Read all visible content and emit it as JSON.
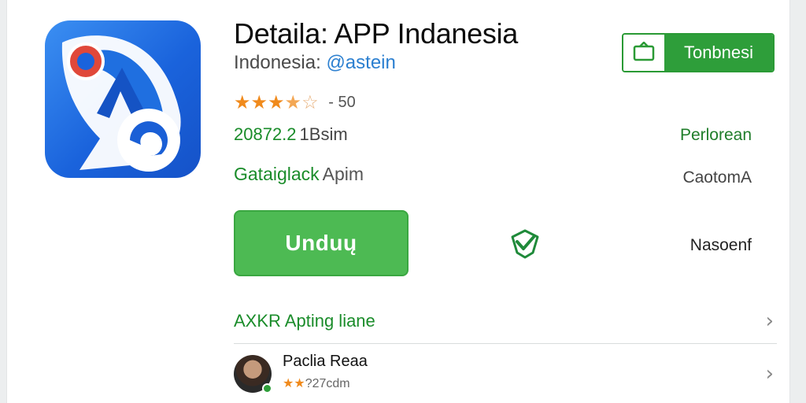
{
  "app": {
    "title": "Detaila: APP Indanesia",
    "developer_prefix": "Indonesia:",
    "developer_name": "@astein",
    "icon": "app-logo-icon",
    "brand_colors": [
      "#1a63dc",
      "#3b8ff2",
      "#e0483a"
    ]
  },
  "rating": {
    "stars": 3.5,
    "max_stars": 5,
    "count_label": "- 50"
  },
  "stats": {
    "downloads_value": "20872.2",
    "downloads_unit": "1Bsim",
    "category": "Gataiglack",
    "category_type": "Apim"
  },
  "header_button": {
    "label": "Tonbnesi",
    "icon": "monitor-icon",
    "color": "#2e9e3a"
  },
  "right_meta": {
    "line1": "Perlorean",
    "line2": "CaotomA",
    "line3": "Nasoenf"
  },
  "install_button": {
    "label": "Unduų",
    "color": "#4dba53"
  },
  "verified": {
    "icon": "verified-check-icon"
  },
  "section": {
    "label": "AXKR Apting liane",
    "chevron": "›"
  },
  "review": {
    "reviewer_name": "Paclia Reaa",
    "stars_text": "★★",
    "sub_text": "?27cdm",
    "chevron": "›"
  }
}
